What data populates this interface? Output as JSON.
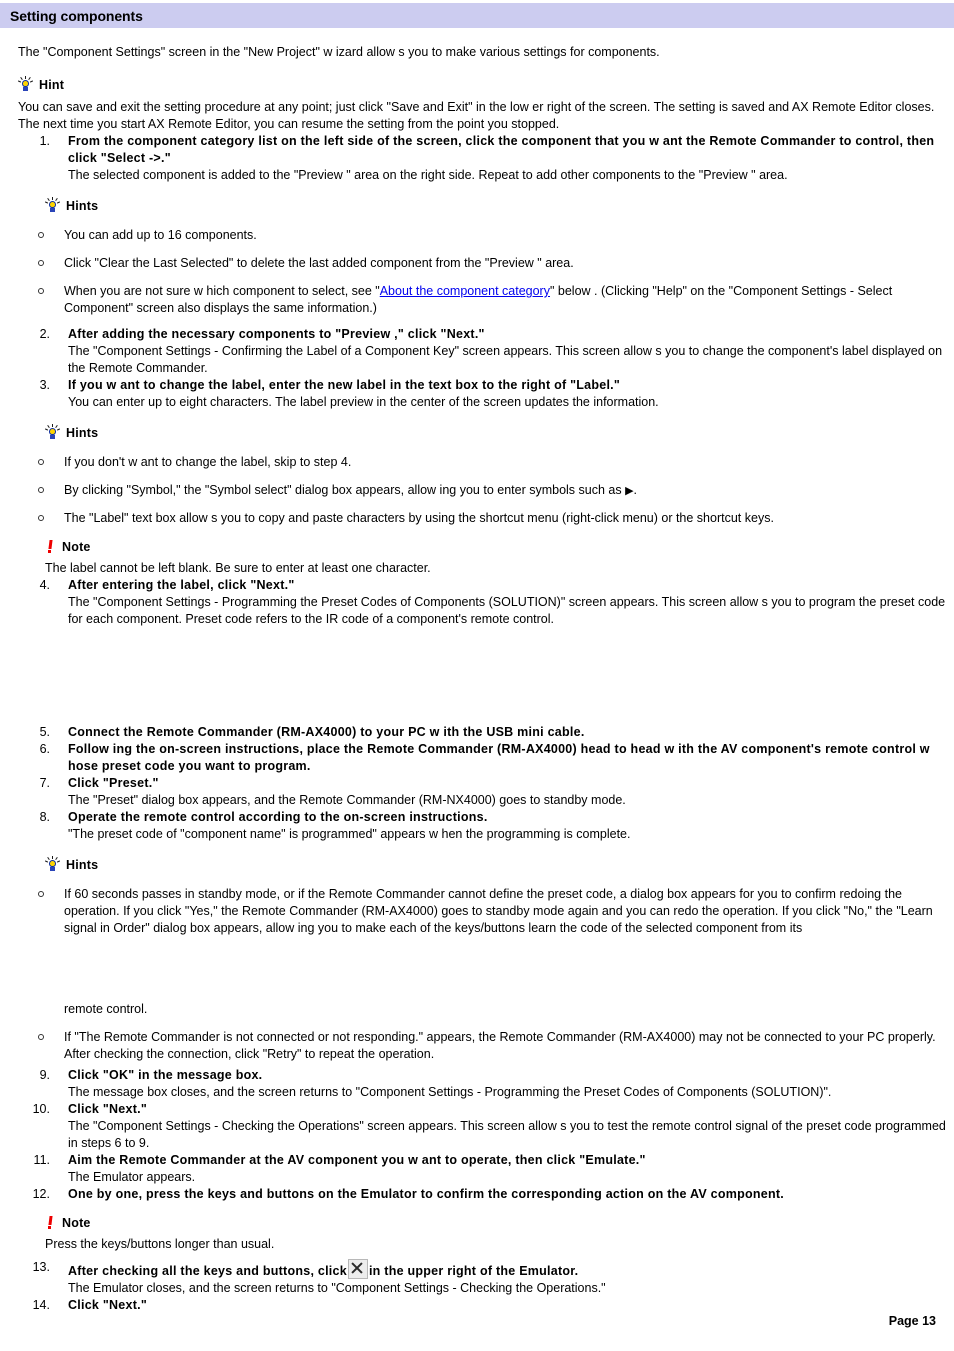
{
  "page": {
    "title": "Setting components",
    "header_bg": "#ccccf0",
    "page_label": "Page 13",
    "link_color": "#0000ee",
    "note_icon_color": "#ee0000"
  },
  "intro": {
    "text": "The \"Component Settings\" screen in the \"New  Project\" w izard allow s you to make various settings for components."
  },
  "hint_top": {
    "label": "Hint",
    "line1": "You can save and exit the setting procedure at any point; just click \"Save and Exit\" in the low er right of the screen. The setting is saved and AX Remote Editor closes.",
    "line2": "The next time you start AX Remote Editor, you can resume the setting from the point you stopped."
  },
  "steps": [
    {
      "num": "1.",
      "head": "From the component category list on the left side of the screen, click the component that you w ant the Remote Commander to control, then click \"Select ->.\"",
      "body": "The selected component is added to the \"Preview \" area on the right side. Repeat to add other components to the \"Preview \" area."
    },
    {
      "num": "2.",
      "head": "After adding the necessary components to \"Preview ,\" click \"Next.\"",
      "body": "The \"Component Settings - Confirming the Label of a Component Key\" screen appears. This screen allow s you to change the component's label displayed on the Remote Commander."
    },
    {
      "num": "3.",
      "head": "If you w ant to change the label, enter the new  label in the text box to the right of \"Label.\"",
      "body": "You can enter up to eight characters. The label preview  in the center of the screen updates the information."
    },
    {
      "num": "4.",
      "head": "After entering the label, click \"Next.\"",
      "body": "The \"Component Settings - Programming the Preset Codes of Components (SOLUTION)\" screen appears. This screen allow s you to program the preset code for each component. Preset code refers to the IR code of a component's remote control."
    },
    {
      "num": "5.",
      "head": "Connect the Remote Commander (RM-AX4000) to your PC w ith the USB mini cable.",
      "body": ""
    },
    {
      "num": "6.",
      "head": "Follow ing the on-screen instructions, place the Remote Commander (RM-AX4000) head to head w ith the AV component's remote control w hose preset code you want to program.",
      "body": ""
    },
    {
      "num": "7.",
      "head": "Click \"Preset.\"",
      "body": "The \"Preset\" dialog box appears, and the Remote Commander (RM-NX4000) goes to standby mode."
    },
    {
      "num": "8.",
      "head": "Operate the remote control according to the on-screen instructions.",
      "body": "\"The preset code of \"component name\" is programmed\" appears w hen the programming is complete."
    },
    {
      "num": "9.",
      "head": "Click \"OK\" in the message box.",
      "body": "The message box closes, and the screen returns to \"Component Settings - Programming the Preset Codes of Components (SOLUTION)\"."
    },
    {
      "num": "10.",
      "head": "Click \"Next.\"",
      "body": "The \"Component Settings - Checking the Operations\" screen appears. This screen allow s you to test the remote control signal of the preset code programmed in steps 6 to 9."
    },
    {
      "num": "11.",
      "head": "Aim the Remote Commander at the AV component you w ant to operate, then click \"Emulate.\"",
      "body": "The Emulator appears."
    },
    {
      "num": "12.",
      "head": "One by one, press the keys and buttons on the Emulator to confirm the corresponding action on the AV component.",
      "body": ""
    },
    {
      "num": "13.",
      "head_before_icon": "After checking all the keys and buttons, click",
      "head_after_icon": "in the upper right of the Emulator.",
      "body": "The Emulator closes, and the screen returns to \"Component Settings - Checking the Operations.\""
    },
    {
      "num": "14.",
      "head": "Click \"Next.\"",
      "body": ""
    }
  ],
  "hints_1": {
    "label": "Hints",
    "items": [
      "You can add up to 16 components.",
      "Click \"Clear the Last Selected\" to delete the last added component from the \"Preview \" area.",
      {
        "before_link": "When you are not sure w hich component to select, see \"",
        "link": "About the component category",
        "after_link": "\" below . (Clicking \"Help\" on the \"Component Settings - Select Component\" screen also displays the same information.)"
      }
    ]
  },
  "hints_2": {
    "label": "Hints",
    "items": [
      "If you don't w ant to change the label, skip to step 4.",
      {
        "before_symbol": "By clicking \"Symbol,\" the \"Symbol select\" dialog box appears, allow ing you to enter symbols such as ",
        "symbol": "▶",
        "after_symbol": "."
      },
      " The \"Label\" text box allow s you to copy and paste characters by using the shortcut menu (right-click menu) or the shortcut keys."
    ]
  },
  "note_1": {
    "label": "Note",
    "text": "The label cannot be left blank. Be sure to enter at least one character."
  },
  "hints_3": {
    "label": "Hints",
    "items": [
      "If 60 seconds passes in standby mode, or if the Remote Commander cannot define the preset code, a dialog box appears for you to confirm redoing the operation. If you click \"Yes,\" the Remote Commander (RM-AX4000) goes to standby mode again and you can redo the operation. If you click \"No,\" the \"Learn signal in Order\" dialog box appears, allow ing you to make each of the keys/buttons learn the code of the selected component from its",
      "If \"The Remote Commander is not connected or not responding.\" appears, the Remote Commander (RM-AX4000) may not be connected to your PC properly. After checking the connection, click \"Retry\" to repeat the operation."
    ],
    "continuation": "remote control."
  },
  "note_2": {
    "label": "Note",
    "text": "Press the keys/buttons longer than usual."
  }
}
